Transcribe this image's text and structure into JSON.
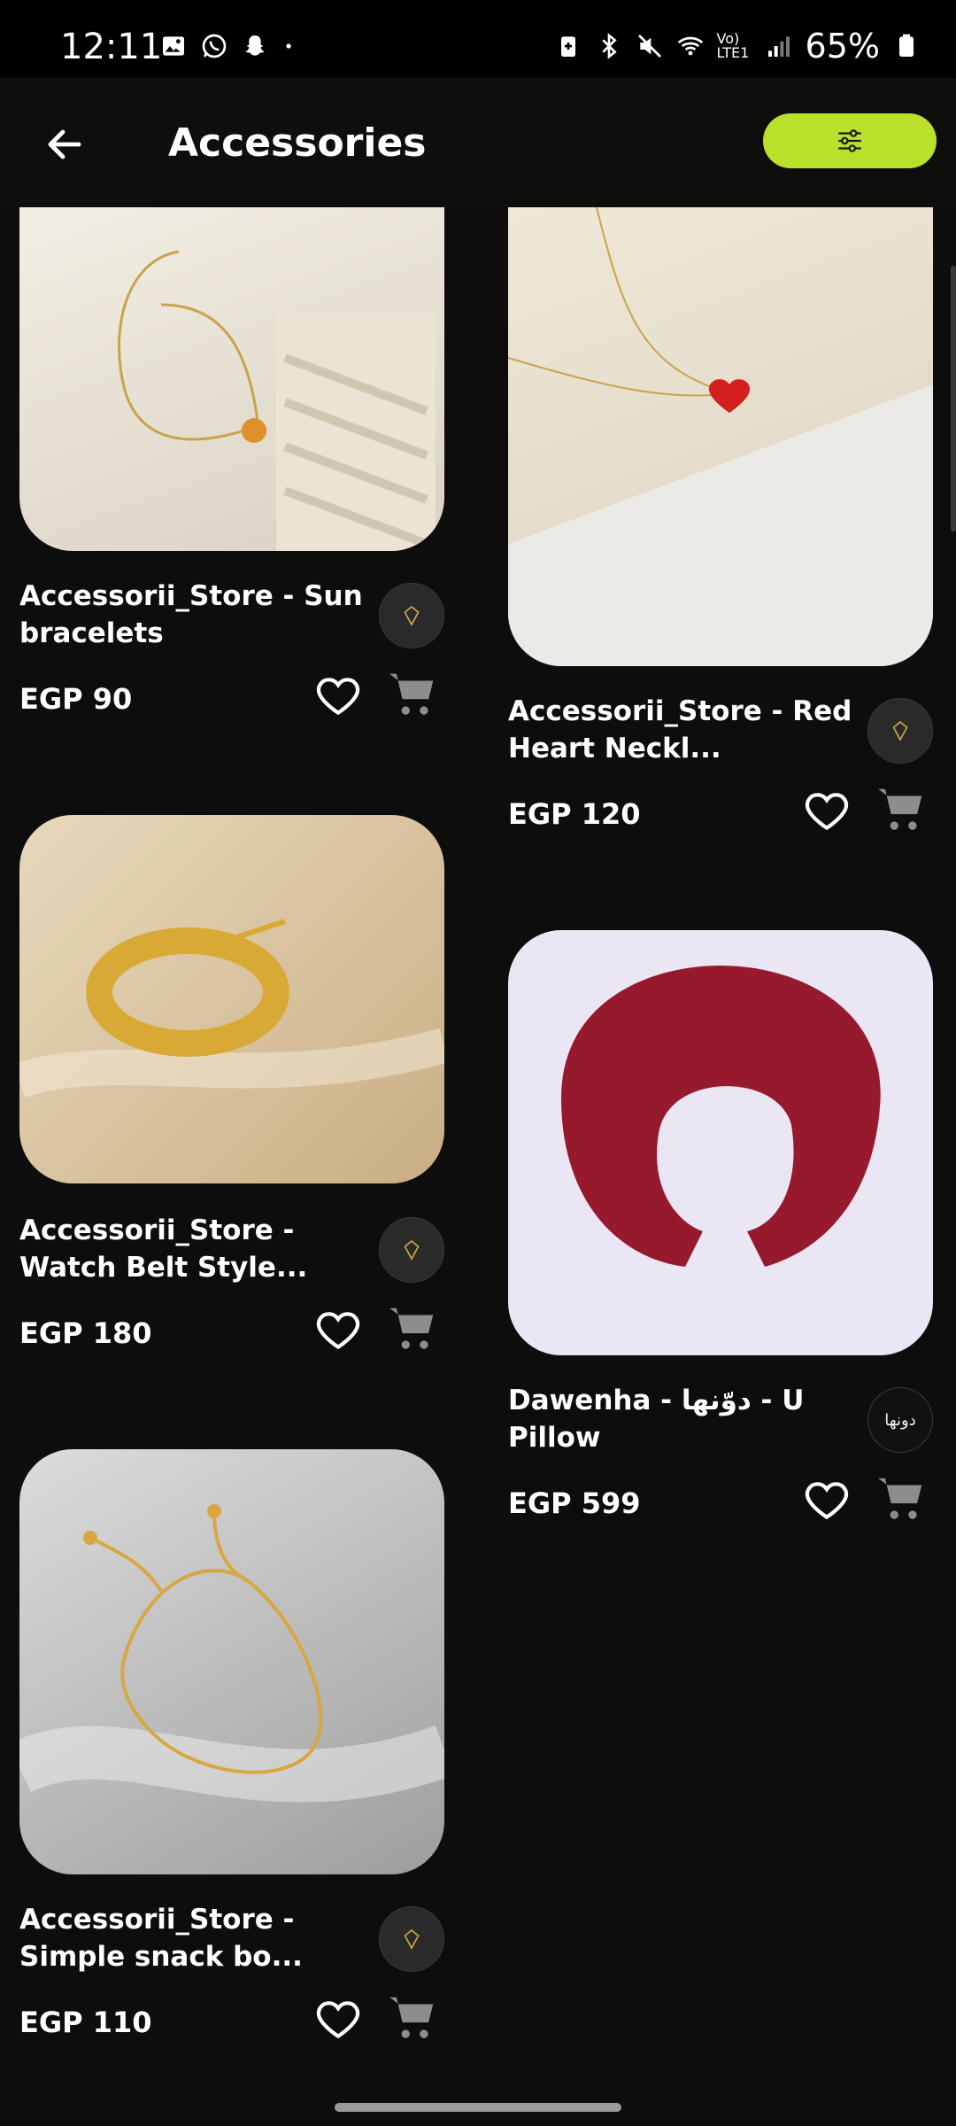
{
  "status_bar": {
    "time": "12:11",
    "battery": "65%",
    "network": "Vo) LTE1",
    "left_icons": [
      "image-icon",
      "whatsapp-icon",
      "snapchat-icon",
      "dot-icon"
    ],
    "right_icons": [
      "battery-saver-icon",
      "bluetooth-icon",
      "mute-icon",
      "wifi-icon",
      "signal-icon"
    ]
  },
  "header": {
    "title": "Accessories",
    "back_icon": "arrow-left-icon",
    "filter_icon": "sliders-icon",
    "accent_color": "#b9e02b"
  },
  "products": [
    {
      "name": "Accessorii_Store - Sun bracelets",
      "price": "EGP 90"
    },
    {
      "name": "Accessorii_Store - Red Heart Neckl...",
      "price": "EGP 120"
    },
    {
      "name": "Accessorii_Store - Watch Belt Style...",
      "price": "EGP 180"
    },
    {
      "name": "Dawenha - دوّنها - U Pillow",
      "price": "EGP 599",
      "logo_text": "دونها"
    },
    {
      "name": "Accessorii_Store - Simple snack bo...",
      "price": "EGP 110"
    }
  ],
  "icons": {
    "favorite": "heart-outline-icon",
    "cart": "cart-icon"
  }
}
